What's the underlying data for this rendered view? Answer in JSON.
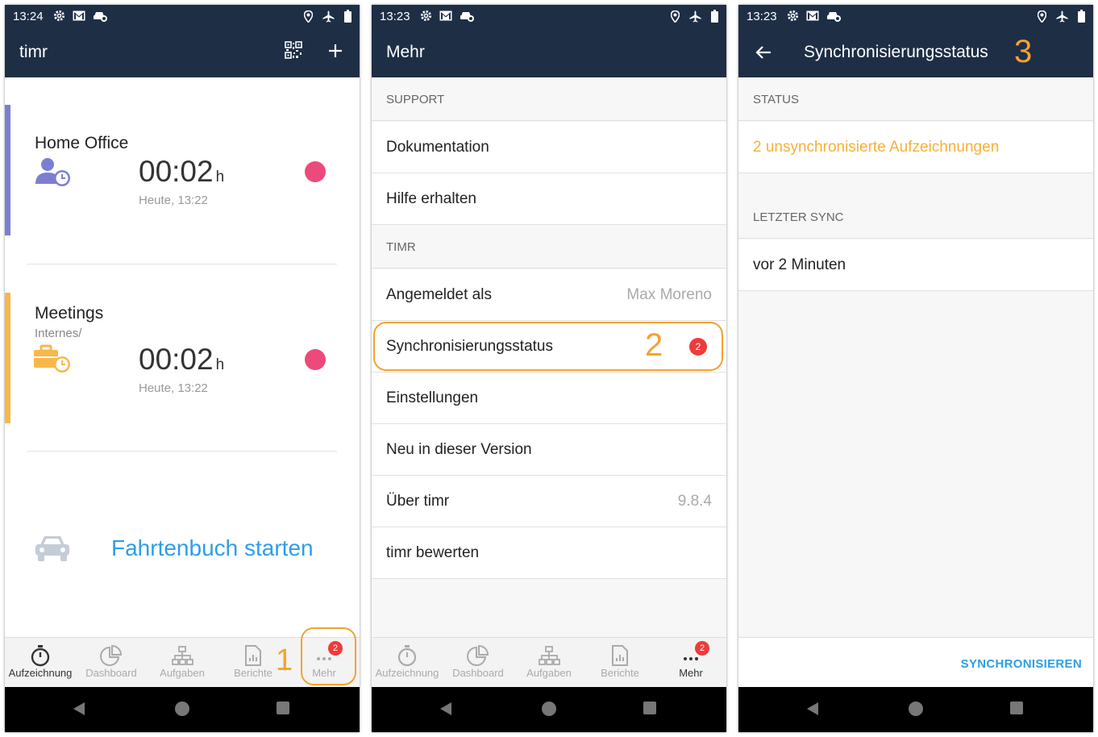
{
  "phone1": {
    "statusbar": {
      "time": "13:24"
    },
    "appbar": {
      "title": "timr"
    },
    "entries": [
      {
        "title": "Home Office",
        "subtitle": "",
        "timer": "00:02",
        "unit": "h",
        "date": "Heute, 13:22",
        "color": "#7b7fd0"
      },
      {
        "title": "Meetings",
        "subtitle": "Internes/",
        "timer": "00:02",
        "unit": "h",
        "date": "Heute, 13:22",
        "color": "#f7b84b"
      }
    ],
    "logbook": {
      "label": "Fahrtenbuch starten"
    },
    "step": "1"
  },
  "phone2": {
    "statusbar": {
      "time": "13:23"
    },
    "appbar": {
      "title": "Mehr"
    },
    "sections": {
      "support": "SUPPORT",
      "timr": "TIMR"
    },
    "rows": {
      "dokumentation": "Dokumentation",
      "hilfe": "Hilfe erhalten",
      "angemeldet": "Angemeldet als",
      "angemeldet_value": "Max Moreno",
      "sync": "Synchronisierungsstatus",
      "sync_badge": "2",
      "einstellungen": "Einstellungen",
      "neu": "Neu in dieser Version",
      "ueber": "Über timr",
      "ueber_value": "9.8.4",
      "bewerten": "timr bewerten"
    },
    "step": "2"
  },
  "phone3": {
    "statusbar": {
      "time": "13:23"
    },
    "appbar": {
      "title": "Synchronisierungsstatus"
    },
    "sections": {
      "status": "STATUS",
      "letzter": "LETZTER SYNC"
    },
    "status_value": "2 unsynchronisierte Aufzeichnungen",
    "last_sync": "vor 2 Minuten",
    "sync_button": "SYNCHRONISIEREN",
    "step": "3"
  },
  "bottomnav": {
    "items": [
      "Aufzeichnung",
      "Dashboard",
      "Aufgaben",
      "Berichte",
      "Mehr"
    ],
    "mehr_badge": "2"
  },
  "colors": {
    "appbar": "#1e2e45",
    "accent": "#2d9ee8",
    "highlight": "#f5a230",
    "record": "#ec4a7a",
    "badge": "#ee3b3b"
  }
}
